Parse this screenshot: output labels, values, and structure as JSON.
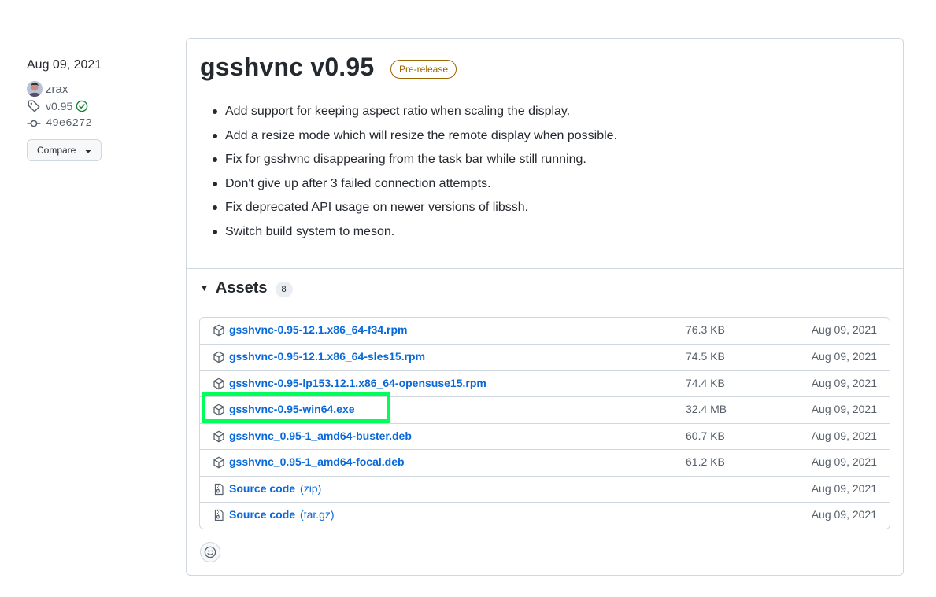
{
  "release": {
    "date": "Aug 09, 2021",
    "author": "zrax",
    "tag": "v0.95",
    "commit": "49e6272",
    "compare_label": "Compare",
    "title": "gsshvnc v0.95",
    "badge": "Pre-release",
    "notes": [
      "Add support for keeping aspect ratio when scaling the display.",
      "Add a resize mode which will resize the remote display when possible.",
      "Fix for gsshvnc disappearing from the task bar while still running.",
      "Don't give up after 3 failed connection attempts.",
      "Fix deprecated API usage on newer versions of libssh.",
      "Switch build system to meson."
    ]
  },
  "assets": {
    "title": "Assets",
    "count": "8",
    "items": [
      {
        "name": "gsshvnc-0.95-12.1.x86_64-f34.rpm",
        "size": "76.3 KB",
        "date": "Aug 09, 2021",
        "icon": "package-icon"
      },
      {
        "name": "gsshvnc-0.95-12.1.x86_64-sles15.rpm",
        "size": "74.5 KB",
        "date": "Aug 09, 2021",
        "icon": "package-icon"
      },
      {
        "name": "gsshvnc-0.95-lp153.12.1.x86_64-opensuse15.rpm",
        "size": "74.4 KB",
        "date": "Aug 09, 2021",
        "icon": "package-icon"
      },
      {
        "name": "gsshvnc-0.95-win64.exe",
        "size": "32.4 MB",
        "date": "Aug 09, 2021",
        "icon": "package-icon"
      },
      {
        "name": "gsshvnc_0.95-1_amd64-buster.deb",
        "size": "60.7 KB",
        "date": "Aug 09, 2021",
        "icon": "package-icon"
      },
      {
        "name": "gsshvnc_0.95-1_amd64-focal.deb",
        "size": "61.2 KB",
        "date": "Aug 09, 2021",
        "icon": "package-icon"
      },
      {
        "name": "Source code",
        "format": "(zip)",
        "size": "",
        "date": "Aug 09, 2021",
        "icon": "file-zip-icon"
      },
      {
        "name": "Source code",
        "format": "(tar.gz)",
        "size": "",
        "date": "Aug 09, 2021",
        "icon": "file-zip-icon"
      }
    ]
  },
  "colors": {
    "link": "#0969da",
    "prerelease": "#9a6700",
    "highlight": "#00ff59",
    "verified": "#1a7f37"
  }
}
